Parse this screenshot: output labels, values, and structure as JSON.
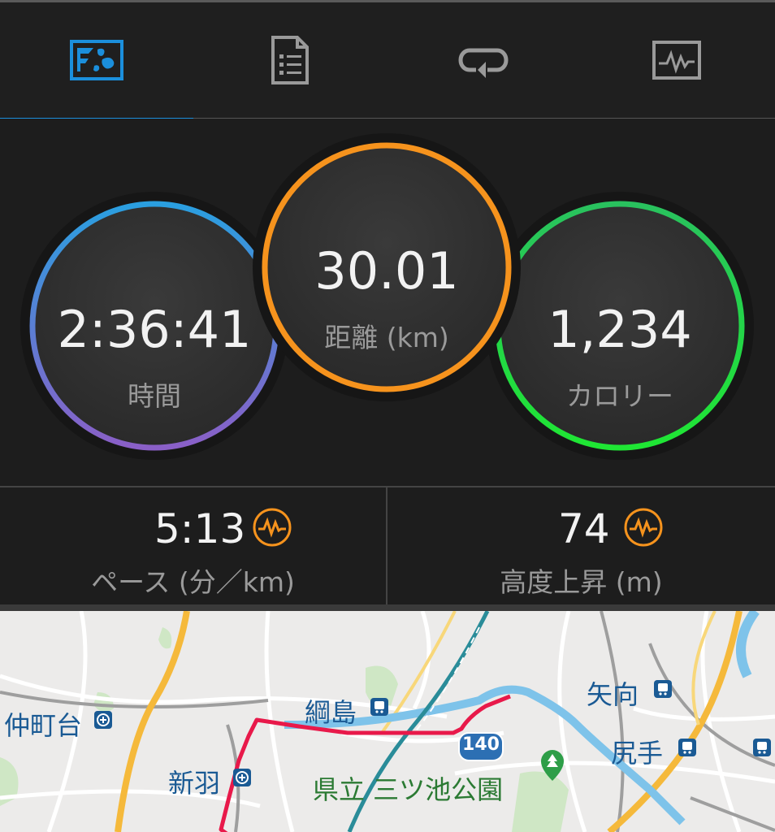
{
  "tabs": [
    {
      "name": "map-overview",
      "icon": "map-overview-icon",
      "active": true
    },
    {
      "name": "details",
      "icon": "document-list-icon",
      "active": false
    },
    {
      "name": "laps",
      "icon": "loop-arrow-icon",
      "active": false
    },
    {
      "name": "charts",
      "icon": "chart-waveform-icon",
      "active": false
    }
  ],
  "stats": {
    "time": {
      "value": "2:36:41",
      "label": "時間"
    },
    "distance": {
      "value": "30.01",
      "label": "距離 (km)"
    },
    "calories": {
      "value": "1,234",
      "label": "カロリー"
    }
  },
  "metrics": {
    "pace": {
      "value": "5:13",
      "label": "ペース (分／km)",
      "icon": "activity-chart-icon"
    },
    "elevation": {
      "value": "74",
      "label": "高度上昇 (m)",
      "icon": "activity-chart-icon"
    }
  },
  "map": {
    "labels": {
      "tsunashima": "綱島",
      "nakamachidai": "仲町台",
      "yakou": "矢向",
      "shitte": "尻手",
      "nippa": "新羽",
      "park": "県立 三ツ池公園",
      "route_number": "140"
    }
  },
  "colors": {
    "accent_blue": "#1b8fdc",
    "ring_orange": "#f6931d",
    "ring_green": "#27d13a",
    "metric_icon": "#f6931d",
    "route_red": "#e8194a"
  }
}
